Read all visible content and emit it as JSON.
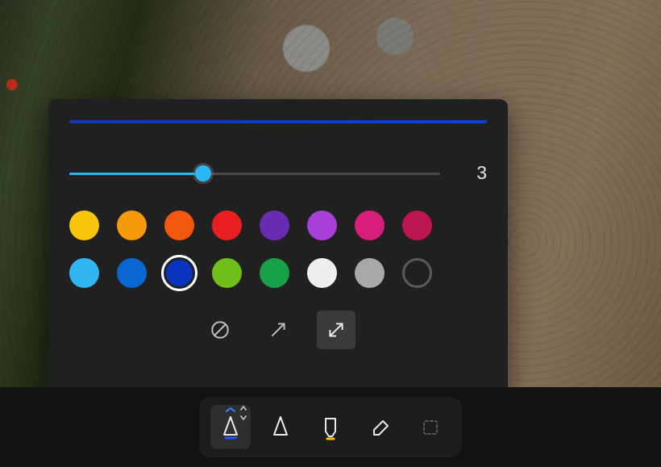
{
  "preview_color": "#0a3fe0",
  "slider": {
    "value": 3,
    "max": 9,
    "fill_pct": 36,
    "accent": "#29b8f5"
  },
  "swatches": [
    {
      "name": "yellow",
      "hex": "#f9c50a",
      "selected": false
    },
    {
      "name": "orange",
      "hex": "#f59b0b",
      "selected": false
    },
    {
      "name": "deep-orange",
      "hex": "#f1580c",
      "selected": false
    },
    {
      "name": "red",
      "hex": "#e91e1e",
      "selected": false
    },
    {
      "name": "violet",
      "hex": "#6a2bb3",
      "selected": false
    },
    {
      "name": "purple",
      "hex": "#a83fd8",
      "selected": false
    },
    {
      "name": "magenta",
      "hex": "#d61e7a",
      "selected": false
    },
    {
      "name": "crimson",
      "hex": "#bd1452",
      "selected": false
    },
    {
      "name": "sky",
      "hex": "#2fb6f3",
      "selected": false
    },
    {
      "name": "azure",
      "hex": "#0a66d0",
      "selected": false
    },
    {
      "name": "blue",
      "hex": "#0a34c0",
      "selected": true
    },
    {
      "name": "lime",
      "hex": "#6fbf1a",
      "selected": false
    },
    {
      "name": "green",
      "hex": "#17a047",
      "selected": false
    },
    {
      "name": "white",
      "hex": "#efefef",
      "selected": false
    },
    {
      "name": "gray",
      "hex": "#a8a8a8",
      "selected": false
    },
    {
      "name": "none",
      "hex": "",
      "selected": false
    }
  ],
  "arrow_styles": [
    {
      "name": "no-head",
      "active": false
    },
    {
      "name": "single-head",
      "active": false
    },
    {
      "name": "double-head",
      "active": true
    }
  ],
  "toolbar": [
    {
      "name": "pen-arrow",
      "active": true,
      "accent": "#2a52ff",
      "expanded": true
    },
    {
      "name": "pen-plain",
      "active": false,
      "accent": ""
    },
    {
      "name": "highlighter",
      "active": false,
      "accent": "#f9c50a"
    },
    {
      "name": "eraser",
      "active": false,
      "accent": ""
    },
    {
      "name": "shape",
      "active": false,
      "accent": "",
      "disabled": true
    }
  ]
}
